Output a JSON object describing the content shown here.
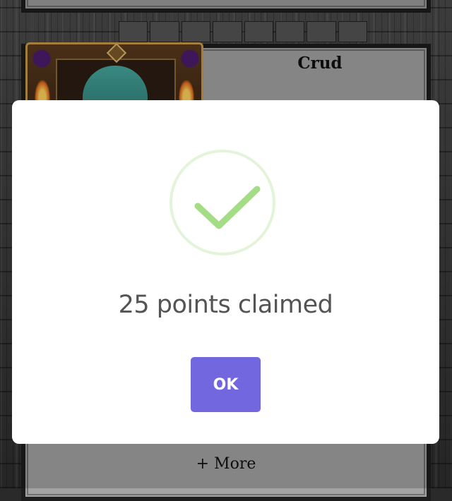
{
  "background": {
    "card": {
      "title": "Crud"
    },
    "more_label": "+ More"
  },
  "modal": {
    "icon": "success-check-icon",
    "title": "25 points claimed",
    "confirm_label": "OK"
  },
  "colors": {
    "confirm_button": "#7367e0",
    "success_check": "#a5dc86",
    "modal_background": "#ffffff",
    "title_text": "#545454"
  }
}
